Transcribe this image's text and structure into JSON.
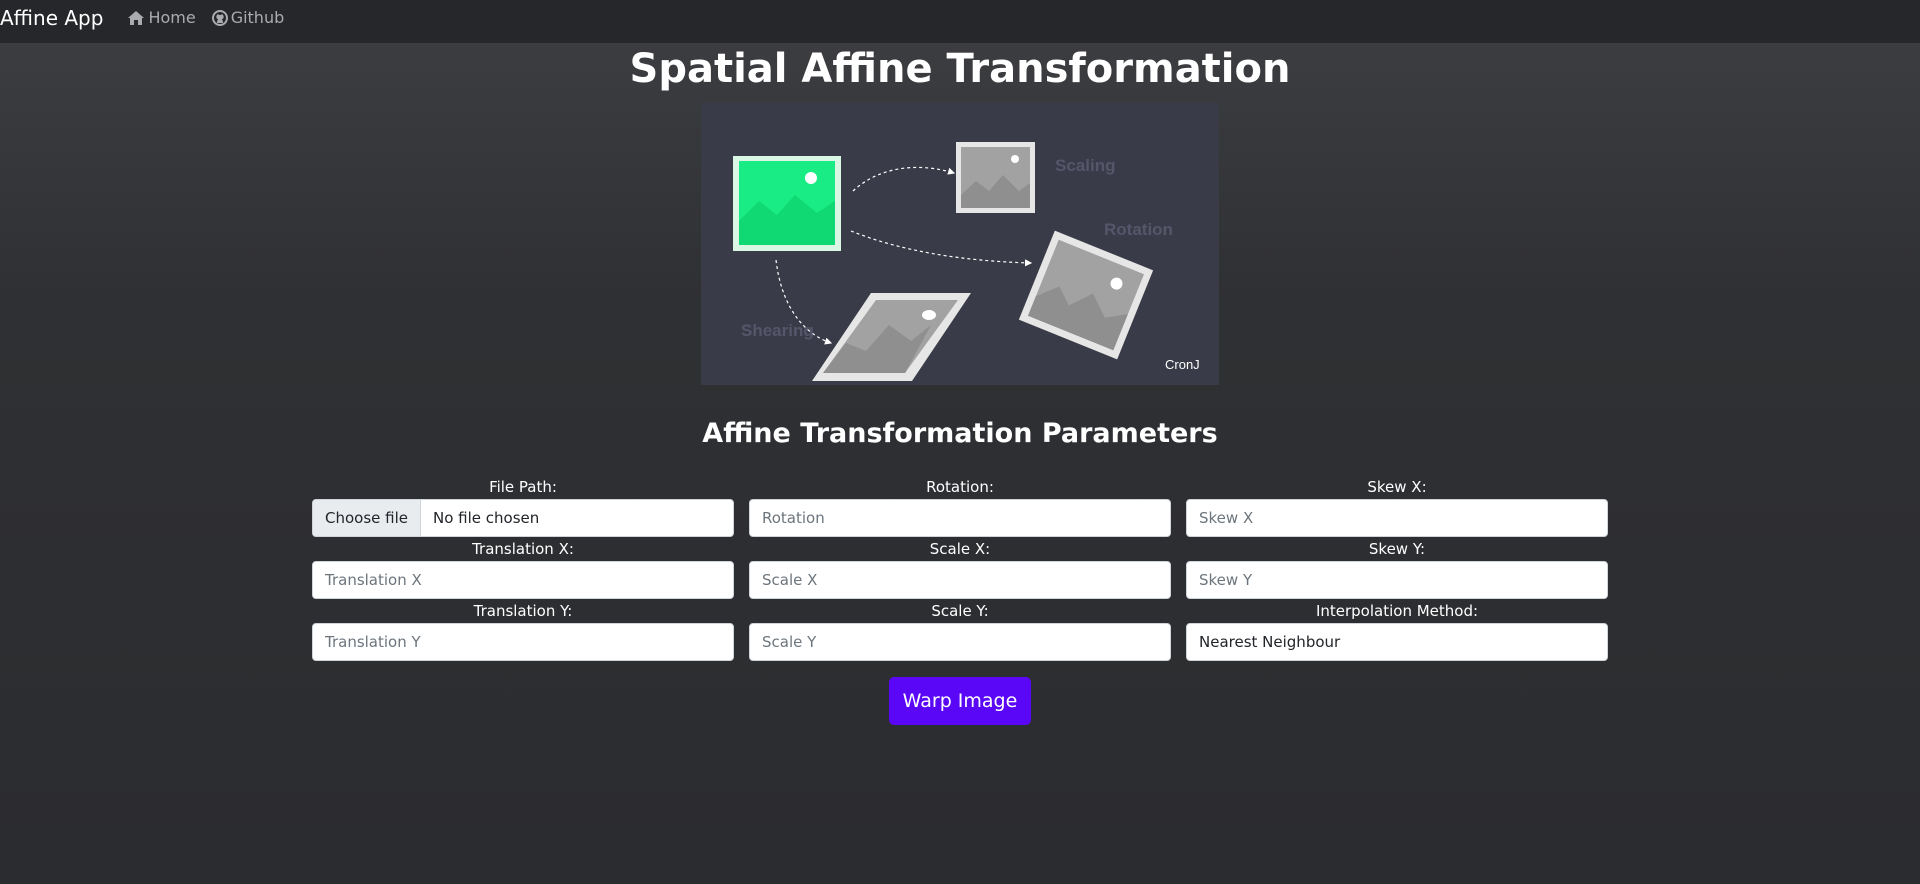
{
  "navbar": {
    "brand": "Affine App",
    "links": [
      {
        "label": "Home",
        "icon": "home-icon"
      },
      {
        "label": "Github",
        "icon": "github-icon"
      }
    ]
  },
  "page_title": "Spatial Affine Transformation",
  "hero": {
    "labels": {
      "scaling": "Scaling",
      "rotation": "Rotation",
      "shearing": "Shearing"
    },
    "credit": "CronJ"
  },
  "section_title": "Affine Transformation Parameters",
  "form": {
    "file_path": {
      "label": "File Path:",
      "button": "Choose file",
      "status": "No file chosen"
    },
    "rotation": {
      "label": "Rotation:",
      "placeholder": "Rotation"
    },
    "skew_x": {
      "label": "Skew X:",
      "placeholder": "Skew X"
    },
    "translation_x": {
      "label": "Translation X:",
      "placeholder": "Translation X"
    },
    "scale_x": {
      "label": "Scale X:",
      "placeholder": "Scale X"
    },
    "skew_y": {
      "label": "Skew Y:",
      "placeholder": "Skew Y"
    },
    "translation_y": {
      "label": "Translation Y:",
      "placeholder": "Translation Y"
    },
    "scale_y": {
      "label": "Scale Y:",
      "placeholder": "Scale Y"
    },
    "interpolation": {
      "label": "Interpolation Method:",
      "value": "Nearest Neighbour"
    }
  },
  "warp_button": "Warp Image",
  "colors": {
    "accent": "#5a06f7",
    "navbar": "#26272a",
    "hero_bg": "#3a3b48"
  }
}
